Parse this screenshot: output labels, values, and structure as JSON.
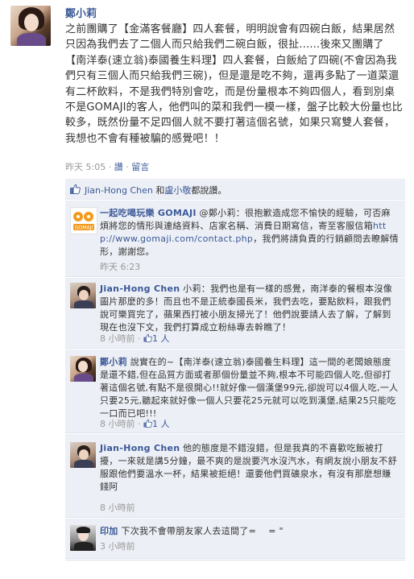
{
  "post": {
    "author": "鄭小莉",
    "text": "之前團購了【金滿客餐廳】四人套餐，明明說會有四碗白飯，結果居然只因為我們去了二個人而只給我們二碗白飯，很扯......後來又團購了【南洋泰(速立翁)泰國養生料理】四人套餐，白飯給了四碗(不會因為我們只有三個人而只給我們三碗)，但是還是吃不夠，還再多點了一道菜還有二杯飲料，不是我們特別會吃，而是份量根本不夠四個人，看到別桌不是GOMAJI的客人，他們叫的菜和我們一模一樣，盤子比較大份量也比較多，既然份量不足四個人就不要打著這個名號，如果只寫雙人套餐，我想也不會有種被騙的感覺吧！！",
    "time": "昨天 5:05",
    "sep": " · ",
    "like_link": "讚",
    "comment_link": "留言"
  },
  "likes": {
    "name1": "Jian-Hong Chen",
    "conj": " 和",
    "name2": "盧小敬",
    "suffix": "都說讚。"
  },
  "comments": [
    {
      "name": "一起吃喝玩樂 GOMAJI",
      "text_before": " @鄭小莉：很抱歉造成您不愉快的經驗，可否麻煩將您的情形與連絡資料、店家名稱、消費日期寫信，寄至客服信箱",
      "url": "http://www.gomaji.com/contact.php",
      "text_after": "，我們將請負責的行銷顧問去瞭解情形，謝謝您。",
      "time": "昨天 6:23"
    },
    {
      "name": "Jian-Hong Chen",
      "text": " 小莉：我們也是有一樣的感覺，南洋泰的餐根本沒像圖片那麼的多！而且也不是正統泰國長米，我們去吃，要點飲料，跟我們說可樂買完了，蘋果西打被小朋友掃光了！他們說要請人去了解，了解到現在也沒下文，我們打算成立粉絲專去幹瞧了！",
      "time": "8 小時前",
      "sep": " · ",
      "likes": "1 人"
    },
    {
      "name": "鄭小莉",
      "text": " 說實在的~【南洋泰(速立翁)泰國養生料理】這一間的老闆娘態度是還不錯,但在品質方面或者那個份量並不夠,根本不可能四個人吃,但卻打著這個名號,有點不是很開心!!就好像一個漢堡99元,卻說可以4個人吃,一人只要25元,聽起來就好像一個人只要花25元就可以吃到漢堡,結果25只能吃一口而已吧!!!",
      "time": "8 小時前",
      "sep": " · ",
      "likes": "1 人"
    },
    {
      "name": "Jian-Hong Chen",
      "text": " 他的態度是不錯沒錯，但是我真的不喜歡吃飯被打擾，一來就是講5分鐘，最不爽的是說要汽水沒汽水，有網友說小朋友不舒服跟他們要溫水一杯，結果被拒絕！還要他們買礦泉水，有沒有那麼想賺錢阿",
      "time": "8 小時前"
    },
    {
      "name": "印加",
      "text": " 下次我不會帶朋友家人去這間了= 　= \"",
      "time": "3 小時前"
    }
  ],
  "icons": {
    "like": "thumbs-up-icon",
    "gomaji_logo": "gomaji-logo-icon"
  },
  "colors": {
    "link": "#3b5998",
    "comment_bg": "#eceff5",
    "meta": "#999999"
  }
}
